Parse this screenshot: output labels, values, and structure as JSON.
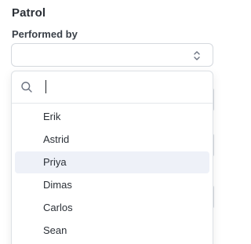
{
  "section": {
    "title": "Patrol"
  },
  "field": {
    "label": "Performed by",
    "value": ""
  },
  "search": {
    "value": "",
    "placeholder": ""
  },
  "options": [
    {
      "label": "Erik",
      "highlighted": false
    },
    {
      "label": "Astrid",
      "highlighted": false
    },
    {
      "label": "Priya",
      "highlighted": true
    },
    {
      "label": "Dimas",
      "highlighted": false
    },
    {
      "label": "Carlos",
      "highlighted": false
    },
    {
      "label": "Sean",
      "highlighted": false
    }
  ],
  "icons": {
    "select_chevron": "chevron-updown-icon",
    "search": "search-icon"
  },
  "colors": {
    "highlight_bg": "#eef1f8",
    "border": "#d5d9de",
    "text": "#2b3037"
  }
}
